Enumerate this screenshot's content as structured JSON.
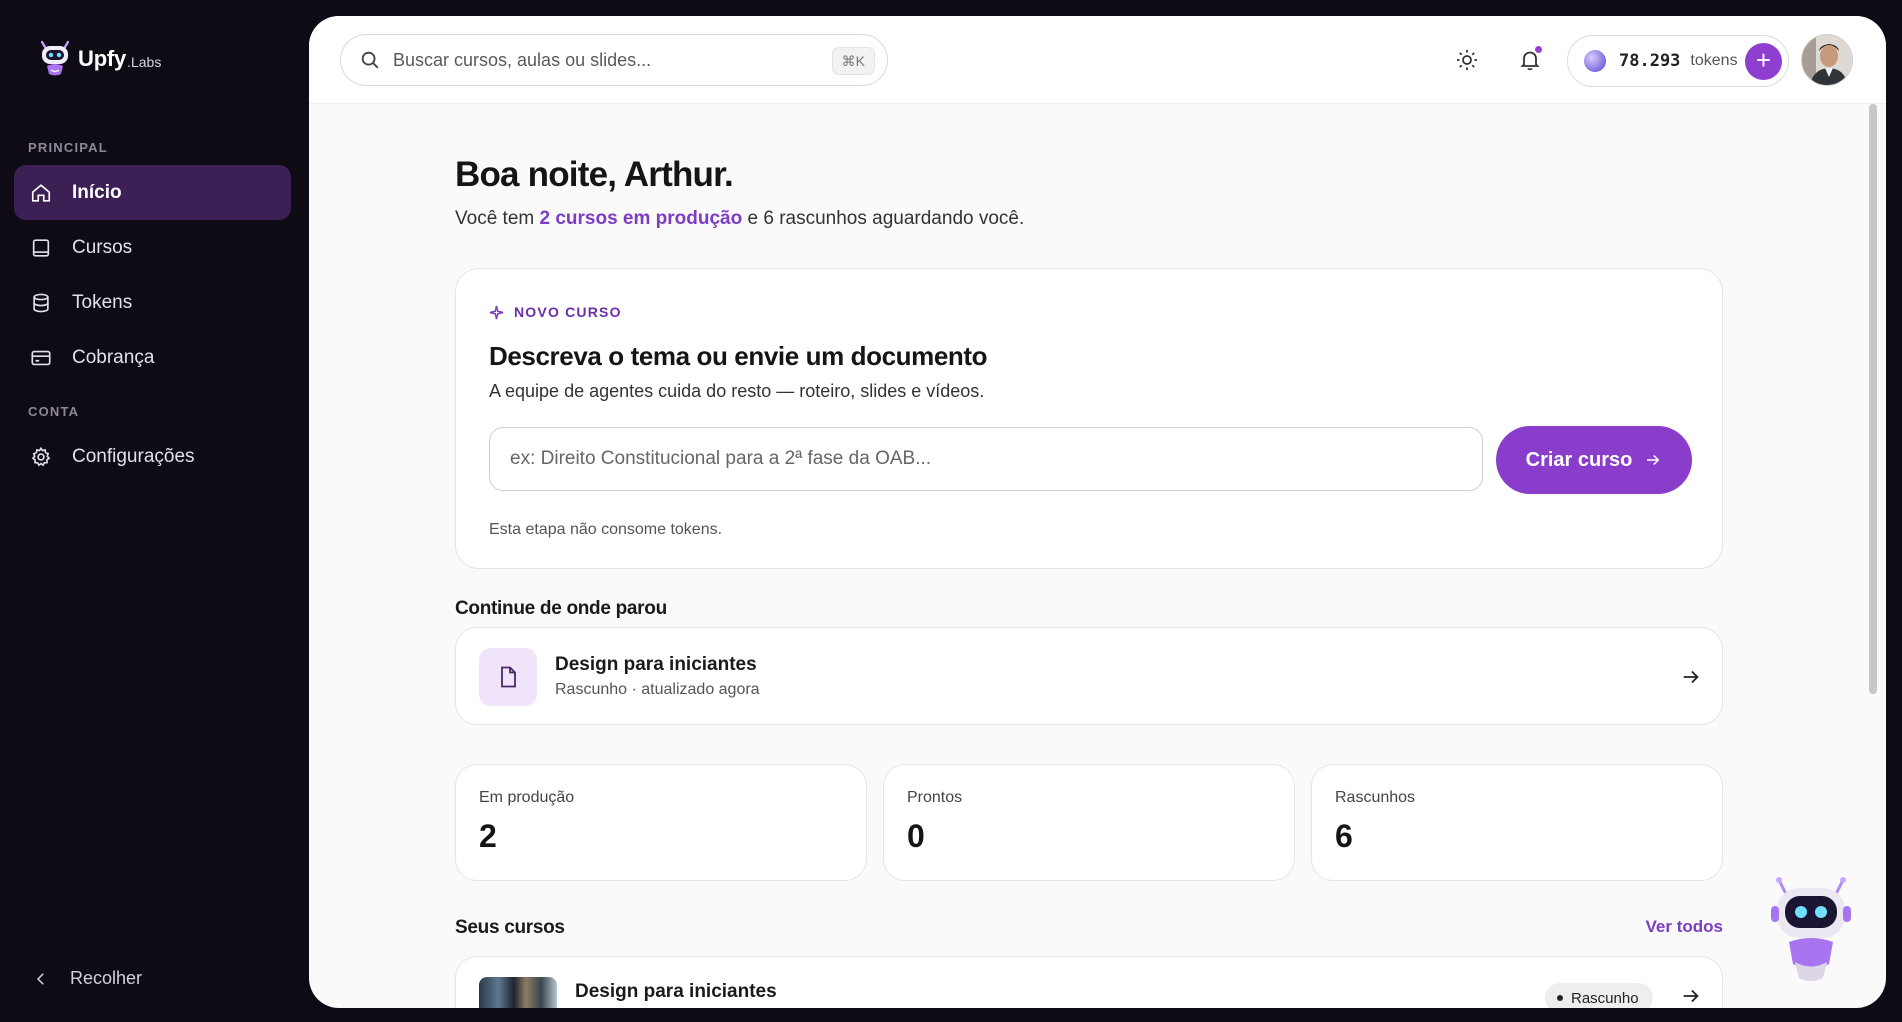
{
  "brand": {
    "name": "Upfy",
    "suffix": ".Labs",
    "icon": "robot-logo-icon"
  },
  "sidebar": {
    "sections": [
      {
        "label": "PRINCIPAL"
      },
      {
        "label": "CONTA"
      }
    ],
    "items": [
      {
        "label": "Início",
        "icon": "home-icon",
        "active": true
      },
      {
        "label": "Cursos",
        "icon": "book-icon",
        "active": false
      },
      {
        "label": "Tokens",
        "icon": "database-icon",
        "active": false
      },
      {
        "label": "Cobrança",
        "icon": "credit-card-icon",
        "active": false
      },
      {
        "label": "Configurações",
        "icon": "gear-icon",
        "active": false
      }
    ],
    "collapse_label": "Recolher"
  },
  "topbar": {
    "search_placeholder": "Buscar cursos, aulas ou slides...",
    "search_shortcut": "⌘K",
    "tokens_count": "78.293",
    "tokens_unit": "tokens",
    "add_label": "+",
    "icons": [
      "sun-icon",
      "bell-icon"
    ]
  },
  "greeting": {
    "title": "Boa noite, Arthur.",
    "sub_prefix": "Você tem",
    "sub_highlight": "2 cursos em produção",
    "sub_suffix": "e 6 rascunhos aguardando você."
  },
  "new_course": {
    "eyebrow": "NOVO CURSO",
    "title": "Descreva o tema ou envie um documento",
    "subtitle": "A equipe de agentes cuida do resto — roteiro, slides e vídeos.",
    "input_placeholder": "ex: Direito Constitucional para a 2ª fase da OAB...",
    "button_label": "Criar curso",
    "note": "Esta etapa não consome tokens."
  },
  "continue": {
    "section_title": "Continue de onde parou",
    "title": "Design para iniciantes",
    "meta": "Rascunho · atualizado agora"
  },
  "stats": [
    {
      "label": "Em produção",
      "value": "2"
    },
    {
      "label": "Prontos",
      "value": "0"
    },
    {
      "label": "Rascunhos",
      "value": "6"
    }
  ],
  "courses": {
    "section_title": "Seus cursos",
    "see_all": "Ver todos",
    "items": [
      {
        "name": "Design para iniciantes",
        "status": "Rascunho"
      }
    ]
  },
  "colors": {
    "accent": "#8a3dcb",
    "sidebar_bg": "#0f0b14",
    "active_item_bg": "#3b1f55"
  }
}
